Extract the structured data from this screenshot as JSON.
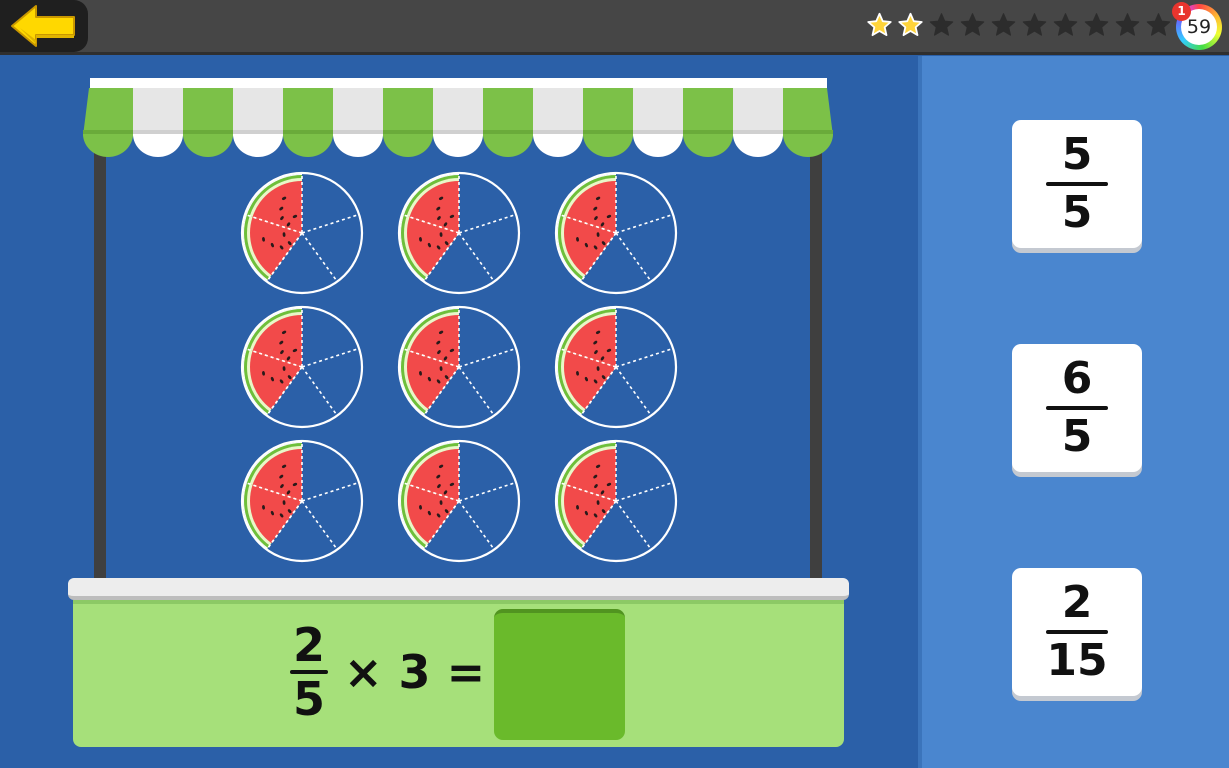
{
  "header": {
    "back_icon": "left-arrow-icon",
    "stars_earned": 2,
    "stars_total": 10,
    "coins": "59",
    "notification_count": "1"
  },
  "colors": {
    "awning_green": "#7cc148",
    "awning_white": "#e6e6e6",
    "stall_bg": "#2b60a8",
    "counter": "#a6e07a",
    "answer_box": "#6aba2b",
    "watermelon_flesh": "#f24a4a",
    "watermelon_rind": "#6ebf3b",
    "star_gold": "#ffd43b"
  },
  "watermelons": {
    "count": 9,
    "slices_per_melon": 5,
    "filled_slices": 2
  },
  "equation": {
    "numerator": "2",
    "denominator": "5",
    "operator": "×",
    "multiplier": "3",
    "equals": "="
  },
  "answers": [
    {
      "numerator": "5",
      "denominator": "5"
    },
    {
      "numerator": "6",
      "denominator": "5"
    },
    {
      "numerator": "2",
      "denominator": "15"
    }
  ]
}
